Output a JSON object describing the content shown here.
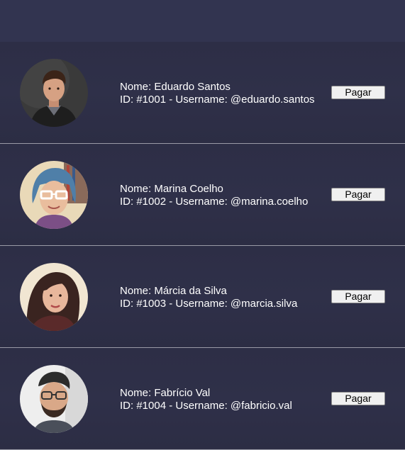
{
  "users": [
    {
      "name_line": "Nome: Eduardo Santos",
      "id_line": "ID: #1001 - Username: @eduardo.santos",
      "pay_label": "Pagar",
      "avatar": "man-dark-hair-portrait"
    },
    {
      "name_line": "Nome: Marina Coelho",
      "id_line": "ID: #1002 - Username: @marina.coelho",
      "pay_label": "Pagar",
      "avatar": "woman-glasses-blue-hair-portrait"
    },
    {
      "name_line": "Nome: Márcia da Silva",
      "id_line": "ID: #1003 - Username: @marcia.silva",
      "pay_label": "Pagar",
      "avatar": "woman-brown-hair-portrait"
    },
    {
      "name_line": "Nome: Fabrício Val",
      "id_line": "ID: #1004 - Username: @fabricio.val",
      "pay_label": "Pagar",
      "avatar": "man-glasses-beard-portrait"
    }
  ]
}
